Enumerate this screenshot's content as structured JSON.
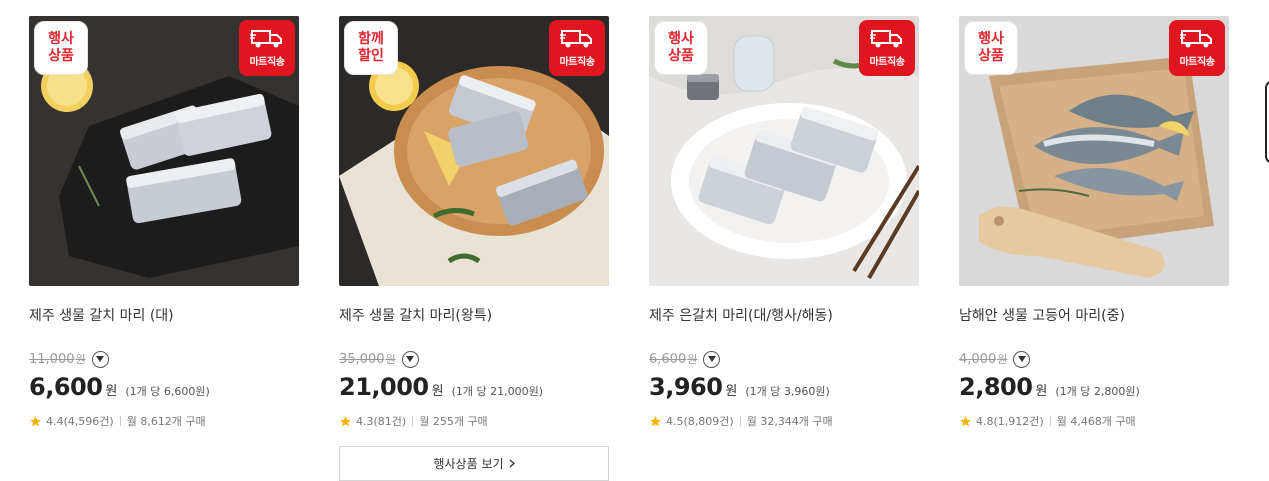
{
  "badge_colors": {
    "accent": "#e0151f",
    "tag_text": "#e0262f",
    "star": "#f5b400"
  },
  "shipping_icon": "delivery-truck-icon",
  "products": [
    {
      "tag": "행사상품",
      "shipping_label": "마트직송",
      "name": "제주 생물 갈치 마리 (대)",
      "original_price": "11,000",
      "original_unit": "원",
      "price": "6,600",
      "price_unit": "원",
      "unit_price": "(1개 당 6,600원)",
      "rating": "4.4",
      "review_count": "(4,596건)",
      "monthly_sales": "월 8,612개 구매"
    },
    {
      "tag": "함께할인",
      "shipping_label": "마트직송",
      "name": "제주 생물 갈치 마리(왕특)",
      "original_price": "35,000",
      "original_unit": "원",
      "price": "21,000",
      "price_unit": "원",
      "unit_price": "(1개 당 21,000원)",
      "rating": "4.3",
      "review_count": "(81건)",
      "monthly_sales": "월 255개 구매",
      "event_button": "행사상품 보기"
    },
    {
      "tag": "행사상품",
      "shipping_label": "마트직송",
      "name": "제주 은갈치 마리(대/행사/해동)",
      "original_price": "6,600",
      "original_unit": "원",
      "price": "3,960",
      "price_unit": "원",
      "unit_price": "(1개 당 3,960원)",
      "rating": "4.5",
      "review_count": "(8,809건)",
      "monthly_sales": "월 32,344개 구매"
    },
    {
      "tag": "행사상품",
      "shipping_label": "마트직송",
      "name": "남해안 생물 고등어 마리(중)",
      "original_price": "4,000",
      "original_unit": "원",
      "price": "2,800",
      "price_unit": "원",
      "unit_price": "(1개 당 2,800원)",
      "rating": "4.8",
      "review_count": "(1,912건)",
      "monthly_sales": "월 4,468개 구매"
    }
  ]
}
